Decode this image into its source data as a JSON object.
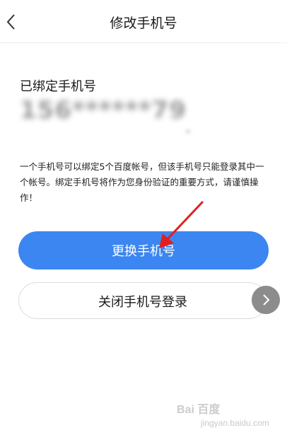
{
  "header": {
    "title": "修改手机号",
    "back_icon": "chevron-left-icon"
  },
  "bound_phone": {
    "label": "已绑定手机号",
    "number": "156******79"
  },
  "info": {
    "text": "一个手机号可以绑定5个百度帐号，但该手机号只能登录其中一个帐号。绑定手机号将作为您身份验证的重要方式，请谨慎操作！"
  },
  "buttons": {
    "change_phone": "更换手机号",
    "close_phone_login": "关闭手机号登录"
  },
  "side_arrow_icon": "chevron-right-icon",
  "annotation_icon": "red-arrow-icon",
  "watermark": {
    "logo": "Bai 百度",
    "site": "jingyan.baidu.com"
  },
  "colors": {
    "primary": "#3b86f0",
    "annotation": "#e02020"
  }
}
